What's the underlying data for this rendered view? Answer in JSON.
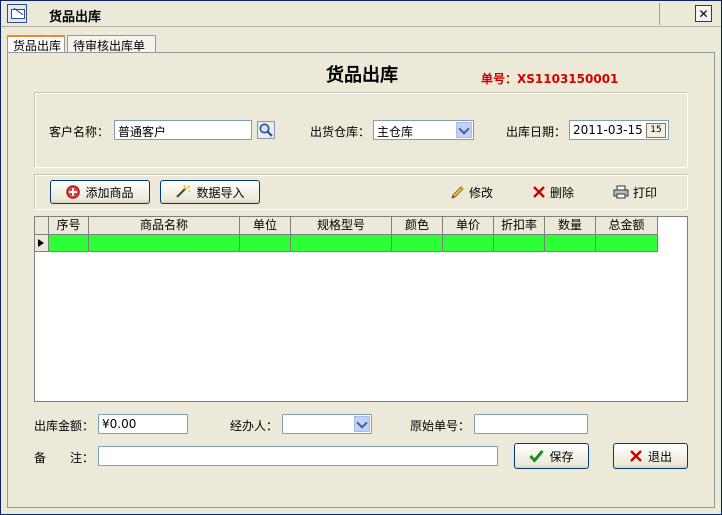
{
  "window": {
    "title": "货品出库",
    "close_glyph": "✕"
  },
  "tabs": [
    {
      "label": "货品出库",
      "active": true
    },
    {
      "label": "待审核出库单",
      "active": false
    }
  ],
  "form": {
    "title": "货品出库",
    "order_no_label": "单号：",
    "order_no": "XS1103150001"
  },
  "header_fields": {
    "customer_label": "客户名称：",
    "customer_value": "普通客户",
    "warehouse_label": "出货仓库：",
    "warehouse_value": "主仓库",
    "date_label": "出库日期：",
    "date_value": "2011-03-15",
    "date_button": "15"
  },
  "toolbar": {
    "add_label": "添加商品",
    "import_label": "数据导入",
    "edit_label": "修改",
    "delete_label": "删除",
    "print_label": "打印"
  },
  "grid": {
    "columns": [
      "序号",
      "商品名称",
      "单位",
      "规格型号",
      "颜色",
      "单价",
      "折扣率",
      "数量",
      "总金额"
    ],
    "rows": [
      [
        "",
        "",
        "",
        "",
        "",
        "",
        "",
        "",
        ""
      ]
    ],
    "selected_row_color": "#2cff35"
  },
  "footer": {
    "amount_label": "出库金额：",
    "amount_value": "¥0.00",
    "handler_label": "经办人：",
    "handler_value": "",
    "orig_no_label": "原始单号：",
    "orig_no_value": "",
    "remark_label": "备　　注：",
    "remark_value": "",
    "save_label": "保存",
    "exit_label": "退出"
  },
  "colors": {
    "order_no": "#d40000",
    "save_check": "#1f8f1f",
    "delete_x": "#cc0000"
  }
}
